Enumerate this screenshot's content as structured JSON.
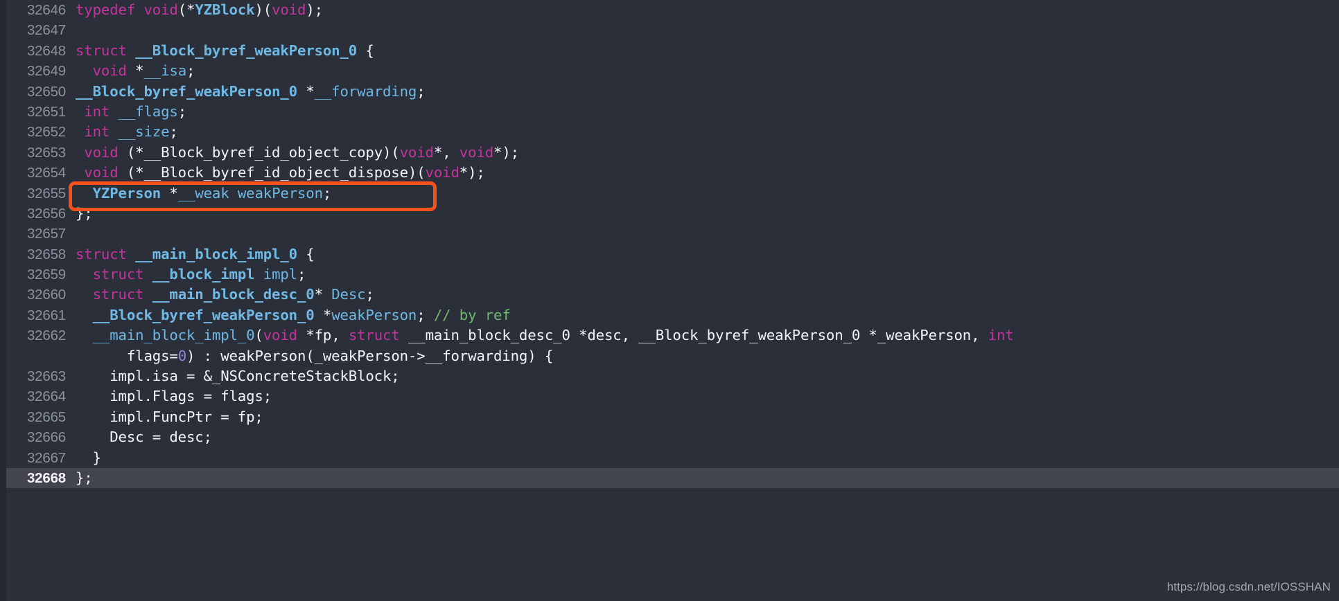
{
  "editor": {
    "theme_background": "#2b2f3a",
    "active_line_background": "#424550",
    "gutter_color": "#8b919c",
    "highlight_box_color": "#f4511e",
    "highlighted_line_number": "32655",
    "lines": [
      {
        "no": "32646",
        "tokens": [
          {
            "t": "typedef",
            "c": "kw"
          },
          {
            "t": " ",
            "c": "pln"
          },
          {
            "t": "void",
            "c": "kw"
          },
          {
            "t": "(*",
            "c": "pln"
          },
          {
            "t": "YZBlock",
            "c": "type"
          },
          {
            "t": ")(",
            "c": "pln"
          },
          {
            "t": "void",
            "c": "kw"
          },
          {
            "t": ");",
            "c": "pln"
          }
        ]
      },
      {
        "no": "32647",
        "tokens": []
      },
      {
        "no": "32648",
        "tokens": [
          {
            "t": "struct",
            "c": "kw"
          },
          {
            "t": " ",
            "c": "pln"
          },
          {
            "t": "__Block_byref_weakPerson_0",
            "c": "type"
          },
          {
            "t": " {",
            "c": "pln"
          }
        ]
      },
      {
        "no": "32649",
        "tokens": [
          {
            "t": "  ",
            "c": "pln"
          },
          {
            "t": "void",
            "c": "kw"
          },
          {
            "t": " *",
            "c": "pln"
          },
          {
            "t": "__isa",
            "c": "var"
          },
          {
            "t": ";",
            "c": "pln"
          }
        ]
      },
      {
        "no": "32650",
        "tokens": [
          {
            "t": "__Block_byref_weakPerson_0",
            "c": "type"
          },
          {
            "t": " *",
            "c": "pln"
          },
          {
            "t": "__forwarding",
            "c": "var"
          },
          {
            "t": ";",
            "c": "pln"
          }
        ]
      },
      {
        "no": "32651",
        "tokens": [
          {
            "t": " ",
            "c": "pln"
          },
          {
            "t": "int",
            "c": "kw"
          },
          {
            "t": " ",
            "c": "pln"
          },
          {
            "t": "__flags",
            "c": "var"
          },
          {
            "t": ";",
            "c": "pln"
          }
        ]
      },
      {
        "no": "32652",
        "tokens": [
          {
            "t": " ",
            "c": "pln"
          },
          {
            "t": "int",
            "c": "kw"
          },
          {
            "t": " ",
            "c": "pln"
          },
          {
            "t": "__size",
            "c": "var"
          },
          {
            "t": ";",
            "c": "pln"
          }
        ]
      },
      {
        "no": "32653",
        "tokens": [
          {
            "t": " ",
            "c": "pln"
          },
          {
            "t": "void",
            "c": "kw"
          },
          {
            "t": " (*__Block_byref_id_object_copy)(",
            "c": "pln"
          },
          {
            "t": "void",
            "c": "kw"
          },
          {
            "t": "*, ",
            "c": "pln"
          },
          {
            "t": "void",
            "c": "kw"
          },
          {
            "t": "*);",
            "c": "pln"
          }
        ]
      },
      {
        "no": "32654",
        "tokens": [
          {
            "t": " ",
            "c": "pln"
          },
          {
            "t": "void",
            "c": "kw"
          },
          {
            "t": " (*__Block_byref_id_object_dispose)(",
            "c": "pln"
          },
          {
            "t": "void",
            "c": "kw"
          },
          {
            "t": "*);",
            "c": "pln"
          }
        ]
      },
      {
        "no": "32655",
        "tokens": [
          {
            "t": "  ",
            "c": "pln"
          },
          {
            "t": "YZPerson",
            "c": "type"
          },
          {
            "t": " *",
            "c": "pln"
          },
          {
            "t": "__weak",
            "c": "var"
          },
          {
            "t": " ",
            "c": "pln"
          },
          {
            "t": "weakPerson",
            "c": "var"
          },
          {
            "t": ";",
            "c": "pln"
          }
        ]
      },
      {
        "no": "32656",
        "tokens": [
          {
            "t": "};",
            "c": "pln"
          }
        ]
      },
      {
        "no": "32657",
        "tokens": []
      },
      {
        "no": "32658",
        "tokens": [
          {
            "t": "struct",
            "c": "kw"
          },
          {
            "t": " ",
            "c": "pln"
          },
          {
            "t": "__main_block_impl_0",
            "c": "type"
          },
          {
            "t": " {",
            "c": "pln"
          }
        ]
      },
      {
        "no": "32659",
        "tokens": [
          {
            "t": "  ",
            "c": "pln"
          },
          {
            "t": "struct",
            "c": "kw"
          },
          {
            "t": " ",
            "c": "pln"
          },
          {
            "t": "__block_impl",
            "c": "type"
          },
          {
            "t": " ",
            "c": "pln"
          },
          {
            "t": "impl",
            "c": "var"
          },
          {
            "t": ";",
            "c": "pln"
          }
        ]
      },
      {
        "no": "32660",
        "tokens": [
          {
            "t": "  ",
            "c": "pln"
          },
          {
            "t": "struct",
            "c": "kw"
          },
          {
            "t": " ",
            "c": "pln"
          },
          {
            "t": "__main_block_desc_0",
            "c": "type"
          },
          {
            "t": "* ",
            "c": "pln"
          },
          {
            "t": "Desc",
            "c": "var"
          },
          {
            "t": ";",
            "c": "pln"
          }
        ]
      },
      {
        "no": "32661",
        "tokens": [
          {
            "t": "  ",
            "c": "pln"
          },
          {
            "t": "__Block_byref_weakPerson_0",
            "c": "type"
          },
          {
            "t": " *",
            "c": "pln"
          },
          {
            "t": "weakPerson",
            "c": "var"
          },
          {
            "t": "; ",
            "c": "pln"
          },
          {
            "t": "// by ref",
            "c": "cmt"
          }
        ]
      },
      {
        "no": "32662",
        "tall": true,
        "tokens": [
          {
            "t": "  ",
            "c": "pln"
          },
          {
            "t": "__main_block_impl_0",
            "c": "var"
          },
          {
            "t": "(",
            "c": "pln"
          },
          {
            "t": "void",
            "c": "kw"
          },
          {
            "t": " *fp, ",
            "c": "pln"
          },
          {
            "t": "struct",
            "c": "kw"
          },
          {
            "t": " __main_block_desc_0 *desc, __Block_byref_weakPerson_0 *_weakPerson, ",
            "c": "pln"
          },
          {
            "t": "int",
            "c": "kw"
          },
          {
            "t": "\n      flags=",
            "c": "pln"
          },
          {
            "t": "0",
            "c": "num"
          },
          {
            "t": ") : weakPerson(_weakPerson->__forwarding) {",
            "c": "pln"
          }
        ]
      },
      {
        "no": "32663",
        "tokens": [
          {
            "t": "    impl.isa = &_NSConcreteStackBlock;",
            "c": "pln"
          }
        ]
      },
      {
        "no": "32664",
        "tokens": [
          {
            "t": "    impl.Flags = flags;",
            "c": "pln"
          }
        ]
      },
      {
        "no": "32665",
        "tokens": [
          {
            "t": "    impl.FuncPtr = fp;",
            "c": "pln"
          }
        ]
      },
      {
        "no": "32666",
        "tokens": [
          {
            "t": "    Desc = desc;",
            "c": "pln"
          }
        ]
      },
      {
        "no": "32667",
        "tokens": [
          {
            "t": "  }",
            "c": "pln"
          }
        ]
      },
      {
        "no": "32668",
        "active": true,
        "tokens": [
          {
            "t": "};",
            "c": "pln"
          }
        ]
      }
    ]
  },
  "watermark": {
    "text": "https://blog.csdn.net/IOSSHAN"
  }
}
